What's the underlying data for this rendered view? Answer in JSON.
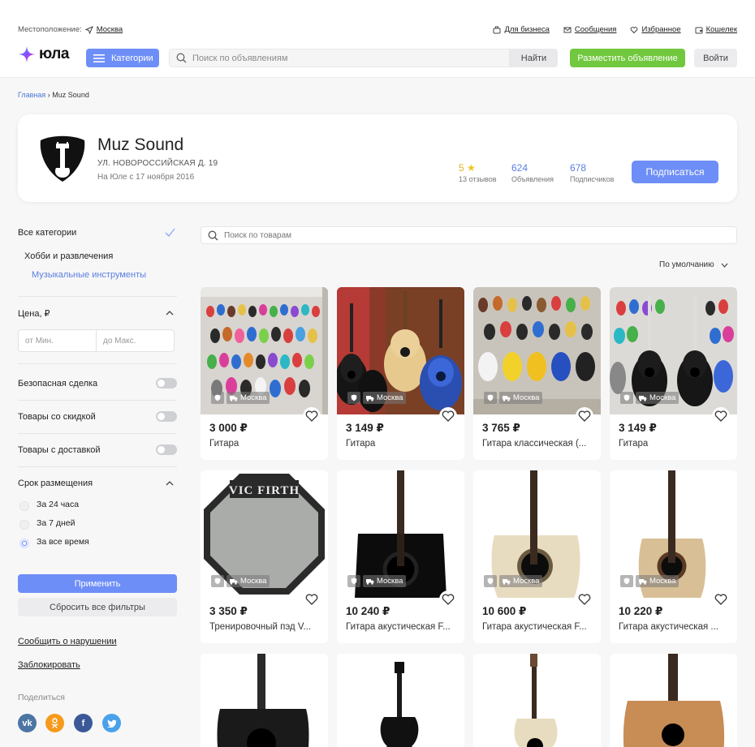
{
  "header": {
    "location_label": "Местоположение:",
    "location_city": "Москва",
    "links": [
      {
        "label": "Для бизнеса",
        "icon": "briefcase-icon"
      },
      {
        "label": "Сообщения",
        "icon": "mail-icon"
      },
      {
        "label": "Избранное",
        "icon": "heart-icon"
      },
      {
        "label": "Кошелек",
        "icon": "wallet-icon"
      }
    ],
    "logo_text": "юла",
    "categories_label": "Категории",
    "search_placeholder": "Поиск по объявлениям",
    "search_button": "Найти",
    "post_button": "Разместить объявление",
    "login_button": "Войти"
  },
  "breadcrumb": {
    "home": "Главная",
    "separator": "›",
    "current": "Muz Sound"
  },
  "store": {
    "name": "Muz Sound",
    "address": "УЛ. НОВОРОССИЙСКАЯ Д. 19",
    "since": "На Юле с 17 ноября 2016",
    "rating": "5",
    "rating_label": "13 отзывов",
    "ads_count": "624",
    "ads_label": "Объявления",
    "subscribers_count": "678",
    "subscribers_label": "Подписчиков",
    "subscribe_button": "Подписаться"
  },
  "sidebar": {
    "all_categories": "Все категории",
    "category": "Хобби и развлечения",
    "subcategory": "Музыкальные инструменты",
    "price_title": "Цена, ₽",
    "price_from": "от Мин.",
    "price_to": "до Макс.",
    "safe_deal": "Безопасная сделка",
    "discount": "Товары со скидкой",
    "delivery": "Товары с доставкой",
    "period_title": "Срок размещения",
    "period_options": [
      "За 24 часа",
      "За 7 дней",
      "За все время"
    ],
    "period_selected": "За все время",
    "apply": "Применить",
    "reset": "Сбросить все фильтры",
    "report": "Сообщить о нарушении",
    "block": "Заблокировать",
    "share": "Поделиться",
    "social": [
      "vk",
      "ok",
      "f",
      "twitter"
    ]
  },
  "products": {
    "search_placeholder": "Поиск по товарам",
    "sort_label": "По умолчанию",
    "city_badge": "Москва",
    "items": [
      {
        "price": "3 000 ₽",
        "title": "Гитара"
      },
      {
        "price": "3 149 ₽",
        "title": "Гитара"
      },
      {
        "price": "3 765 ₽",
        "title": "Гитара классическая (..."
      },
      {
        "price": "3 149 ₽",
        "title": "Гитара"
      },
      {
        "price": "3 350 ₽",
        "title": "Тренировочный пэд V...",
        "brand_text": "VIC FIRTH"
      },
      {
        "price": "10 240 ₽",
        "title": "Гитара акустическая F..."
      },
      {
        "price": "10 600 ₽",
        "title": "Гитара акустическая F..."
      },
      {
        "price": "10 220 ₽",
        "title": "Гитара акустическая ..."
      }
    ]
  },
  "colors": {
    "accent": "#6e8ef7",
    "green": "#71c83e",
    "link": "#4a78d4",
    "star": "#f0c419"
  }
}
